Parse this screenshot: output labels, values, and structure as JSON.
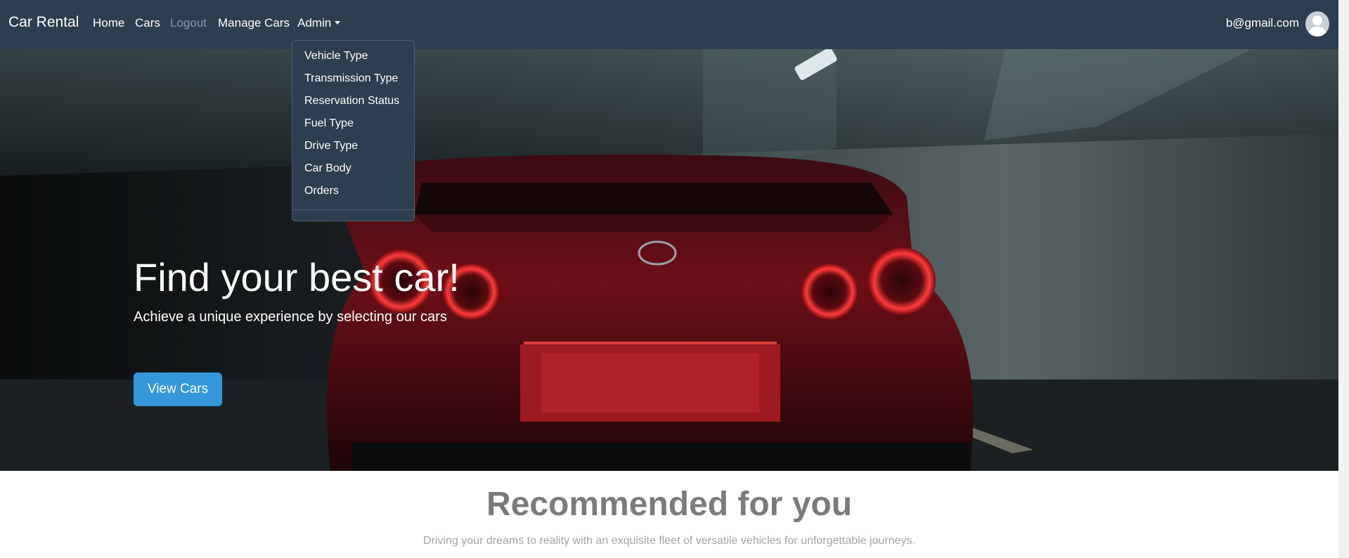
{
  "navbar": {
    "brand": "Car Rental",
    "links": {
      "home": "Home",
      "cars": "Cars",
      "logout": "Logout",
      "manage_cars": "Manage Cars",
      "admin": "Admin"
    },
    "user_email": "b@gmail.com",
    "bg_color": "#2c3e50"
  },
  "admin_menu": {
    "items": [
      "Vehicle Type",
      "Transmission Type",
      "Reservation Status",
      "Fuel Type",
      "Drive Type",
      "Car Body",
      "Orders"
    ]
  },
  "hero": {
    "title": "Find your best car!",
    "subtitle": "Achieve a unique experience by selecting our cars",
    "button_label": "View Cars",
    "button_color": "#3498db"
  },
  "recommended": {
    "title": "Recommended for you",
    "subtitle": "Driving your dreams to reality with an exquisite fleet of versatile vehicles for unforgettable journeys."
  }
}
